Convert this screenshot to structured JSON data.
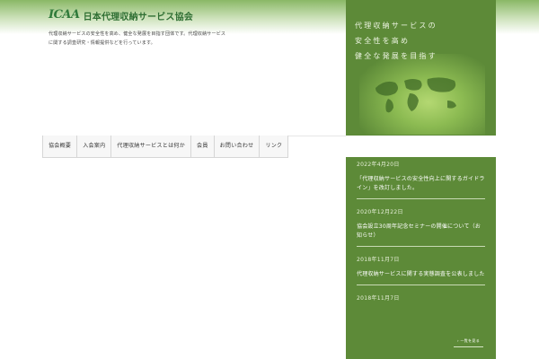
{
  "header": {
    "logo_mark": "ICAA",
    "org_name": "日本代理収納サービス協会",
    "description": "代理収納サービスの安全性を高め、健全な発展を目指す団体です。代理収納サービスに関する調査研究・情報提供などを行っています。"
  },
  "hero": {
    "lines": [
      "代理収納サービスの",
      "安全性を高め",
      "健全な発展を目指す"
    ]
  },
  "nav": {
    "items": [
      "協会概要",
      "入会案内",
      "代理収納サービスとは何か",
      "会員",
      "お問い合わせ",
      "リンク"
    ]
  },
  "news": {
    "items": [
      {
        "date": "2022年4月20日",
        "title": ""
      },
      {
        "date": "",
        "title": "「代理収納サービスの安全性向上に関するガイドライン」を改訂しました。"
      },
      {
        "date": "2020年12月22日",
        "title": "協会設立30周年記念セミナーの開催について（お知らせ）"
      },
      {
        "date": "2018年11月7日",
        "title": "代理収納サービスに関する実態調査を公表しました"
      },
      {
        "date": "2018年11月7日",
        "title": ""
      }
    ],
    "more_label": "一覧を見る"
  },
  "colors": {
    "brand_green": "#5d8a38",
    "logo_green": "#2f7a3a"
  }
}
